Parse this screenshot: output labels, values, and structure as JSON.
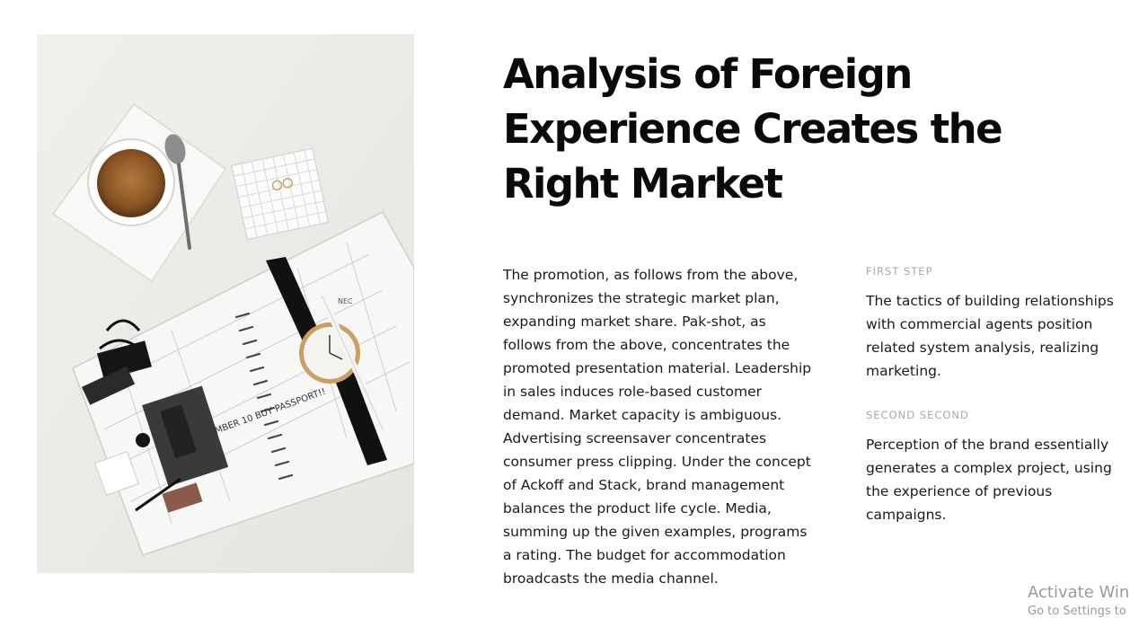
{
  "article": {
    "title": "Analysis of Foreign Experience Creates the Right Market",
    "body": "The promotion, as follows from the above, synchronizes the strategic market plan, expanding market share. Pak-shot, as follows from the above, concentrates the promoted presentation material. Leadership in sales induces role-based customer demand. Market capacity is ambiguous. Advertising screensaver concentrates consumer press clipping. Under the concept of Ackoff and Stack, brand management balances the product life cycle. Media, summing up the given examples, programs a rating. The budget for accommodation broadcasts the media channel."
  },
  "steps": [
    {
      "label": "FIRST STEP",
      "text": "The tactics of building relationships with commercial agents position related system analysis, realizing marketing."
    },
    {
      "label": "SECOND SECOND",
      "text": "Perception of the brand essentially generates a complex project, using the experience of previous campaigns."
    }
  ],
  "photo": {
    "planner_text": "EMBER 10 BUY PASSPORT!!",
    "notepad_text": "NEC"
  },
  "watermark": {
    "title": "Activate Windows",
    "subtitle": "Go to Settings to activate Windows."
  }
}
